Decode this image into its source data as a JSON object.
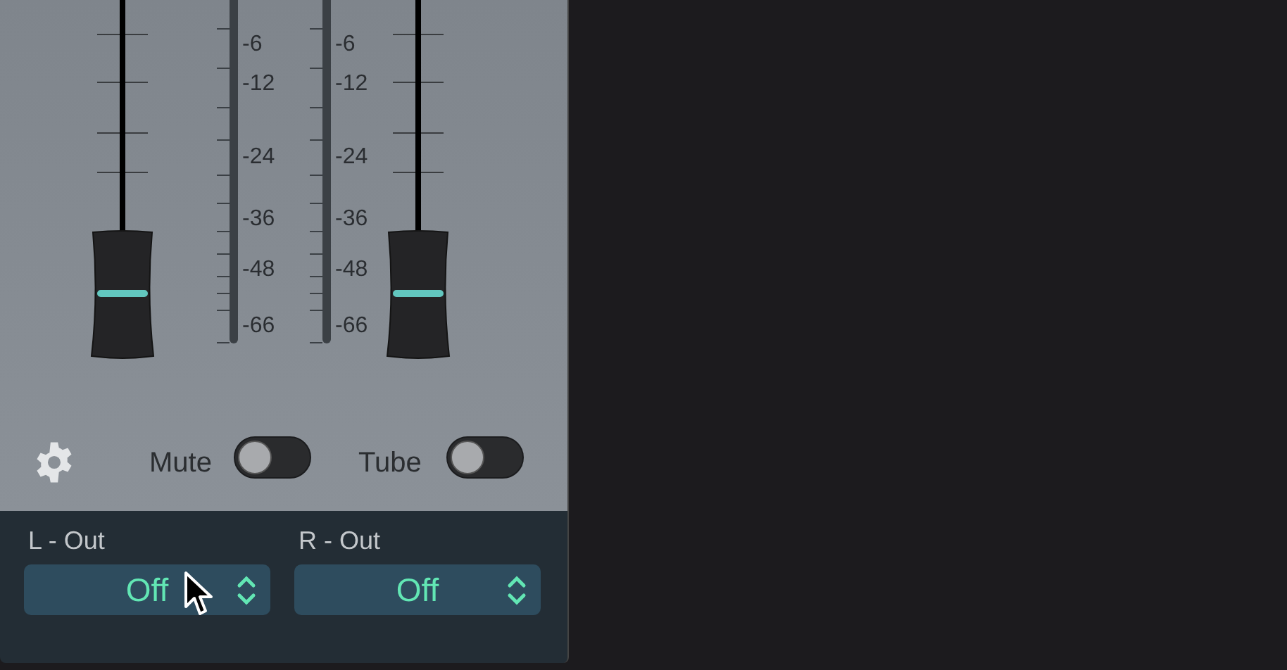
{
  "meters": [
    {
      "scale": [
        "-6",
        "-12",
        "-24",
        "-36",
        "-48",
        "-66"
      ]
    },
    {
      "scale": [
        "-6",
        "-12",
        "-24",
        "-36",
        "-48",
        "-66"
      ]
    }
  ],
  "switches": [
    {
      "label": "Mute",
      "on": false
    },
    {
      "label": "Tube",
      "on": false
    }
  ],
  "outputs": [
    {
      "label": "L - Out",
      "value": "Off"
    },
    {
      "label": "R - Out",
      "value": "Off"
    }
  ]
}
